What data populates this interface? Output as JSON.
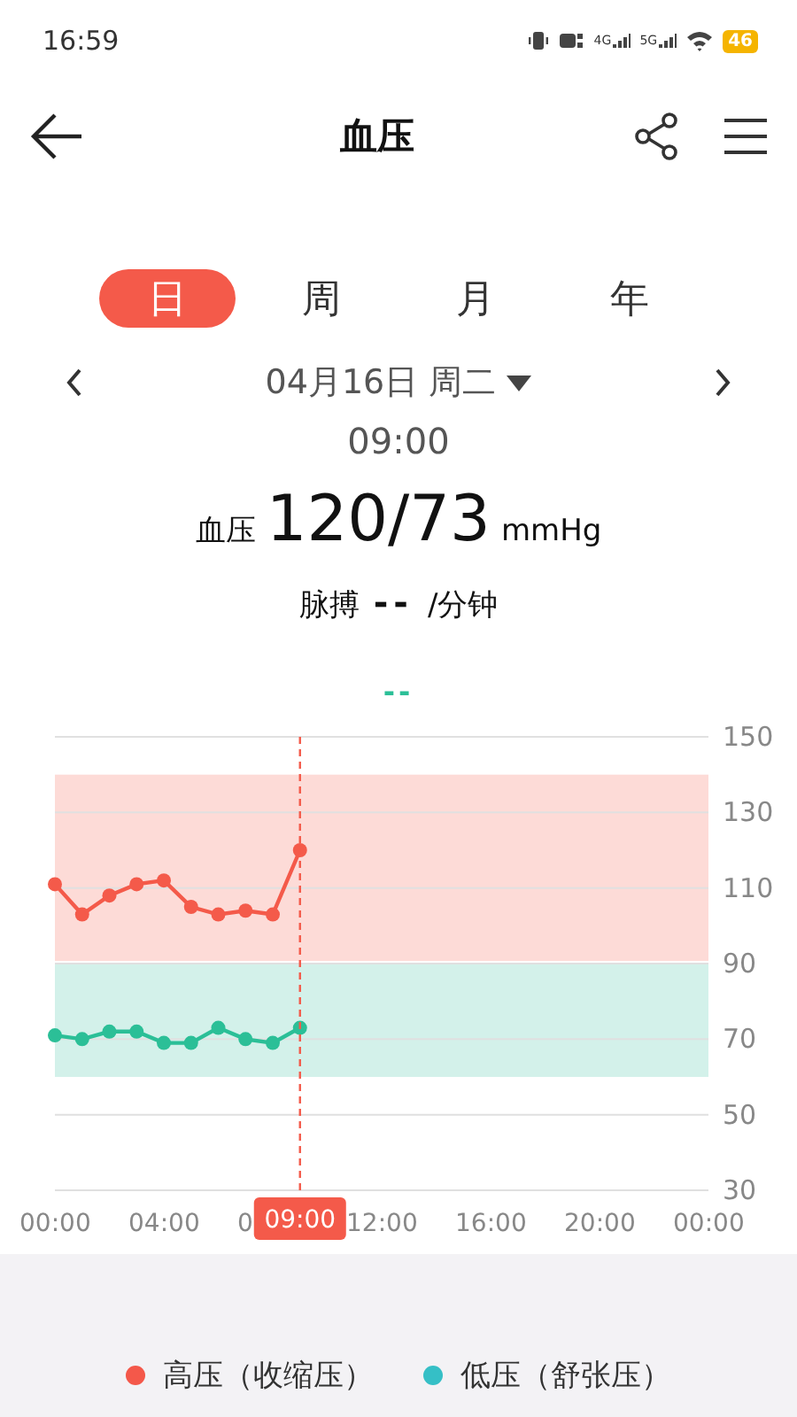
{
  "status_bar": {
    "time": "16:59",
    "networks": [
      "4G",
      "5G"
    ],
    "battery": "46"
  },
  "header": {
    "title": "血压"
  },
  "tabs": [
    {
      "label": "日",
      "selected": true
    },
    {
      "label": "周",
      "selected": false
    },
    {
      "label": "月",
      "selected": false
    },
    {
      "label": "年",
      "selected": false
    }
  ],
  "date_nav": {
    "date": "04月16日 周二",
    "time": "09:00"
  },
  "reading": {
    "label": "血压",
    "value": "120/73",
    "unit": "mmHg"
  },
  "pulse": {
    "label": "脉搏",
    "value": "--",
    "unit": "/分钟"
  },
  "chart": {
    "pulse_value": "--",
    "chart_data": {
      "type": "line",
      "x": [
        0,
        1,
        2,
        3,
        4,
        5,
        6,
        7,
        8,
        9
      ],
      "series": [
        {
          "name": "高压（收缩压）",
          "color": "#f45a4a",
          "marker": "circle",
          "values": [
            111,
            103,
            108,
            111,
            112,
            105,
            103,
            104,
            103,
            120
          ]
        },
        {
          "name": "低压（舒张压）",
          "color": "#2bbf97",
          "marker": "circle",
          "values": [
            71,
            70,
            72,
            72,
            69,
            69,
            73,
            70,
            69,
            73
          ]
        }
      ],
      "xlim": [
        0,
        24
      ],
      "ylim": [
        30,
        150
      ],
      "xticks": [
        {
          "value": 0,
          "label": "00:00"
        },
        {
          "value": 4,
          "label": "04:00"
        },
        {
          "value": 12,
          "label": "12:00"
        },
        {
          "value": 16,
          "label": "16:00"
        },
        {
          "value": 20,
          "label": "20:00"
        },
        {
          "value": 24,
          "label": "00:00"
        }
      ],
      "yticks": [
        30,
        50,
        70,
        90,
        110,
        130,
        150
      ],
      "grid": true,
      "bands": [
        {
          "axis": "y",
          "from": 90,
          "to": 140,
          "color": "#fddbd7"
        },
        {
          "axis": "y",
          "from": 60,
          "to": 90,
          "color": "#d3f1ea"
        }
      ],
      "ref_lines": [
        {
          "axis": "x",
          "value": 9,
          "label": "09:00"
        }
      ]
    },
    "covered_tick_label": "0"
  },
  "legend": [
    {
      "color": "#f4584a"
    },
    {
      "color": "#35bfc6"
    }
  ]
}
